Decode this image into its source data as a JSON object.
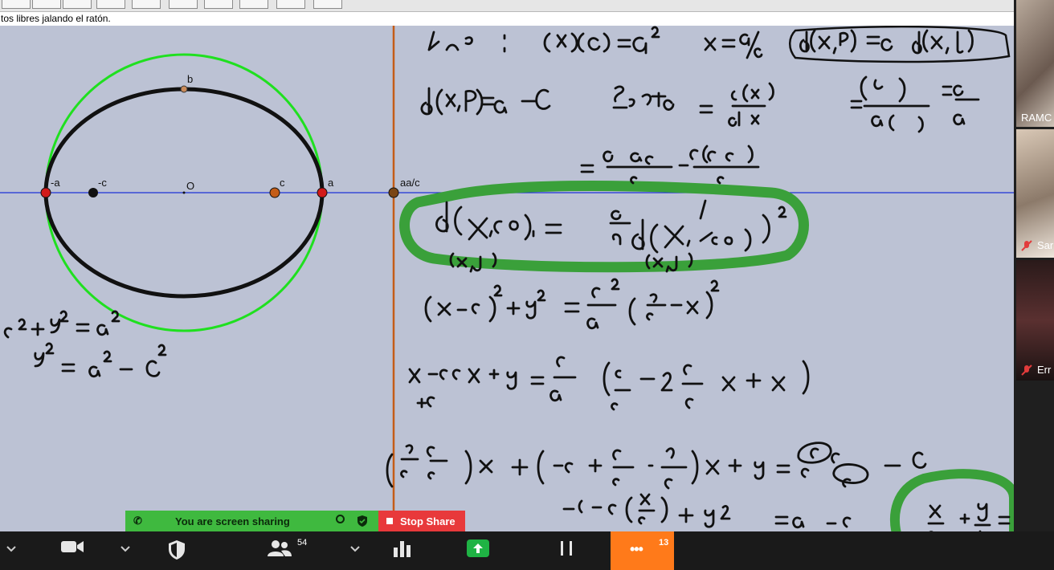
{
  "toolbar": {
    "status_hint": "tos libres jalando el ratón."
  },
  "geometry": {
    "points": {
      "neg_a": "-a",
      "neg_c": "-c",
      "origin": "O",
      "c": "c",
      "a": "a",
      "b": "b",
      "directrix": "aa/c"
    }
  },
  "participants": [
    {
      "name": "RAMC",
      "muted": false
    },
    {
      "name": "Sar",
      "muted": true
    },
    {
      "name": "Err",
      "muted": true
    }
  ],
  "share": {
    "banner_text": "You are screen sharing",
    "stop_label": "Stop Share"
  },
  "controls": {
    "participants_count": "54",
    "more_count": "13",
    "more_label": "•••"
  },
  "colors": {
    "canvas_bg": "#bcc2d4",
    "axis_blue": "#1c31d6",
    "directrix_orange": "#c45d18",
    "circle_green": "#1fe01f",
    "ink_black": "#111111",
    "highlight_green": "#3aa03a",
    "share_green": "#3fb93f",
    "stop_red": "#e8393b",
    "more_orange": "#ff7a1a"
  }
}
